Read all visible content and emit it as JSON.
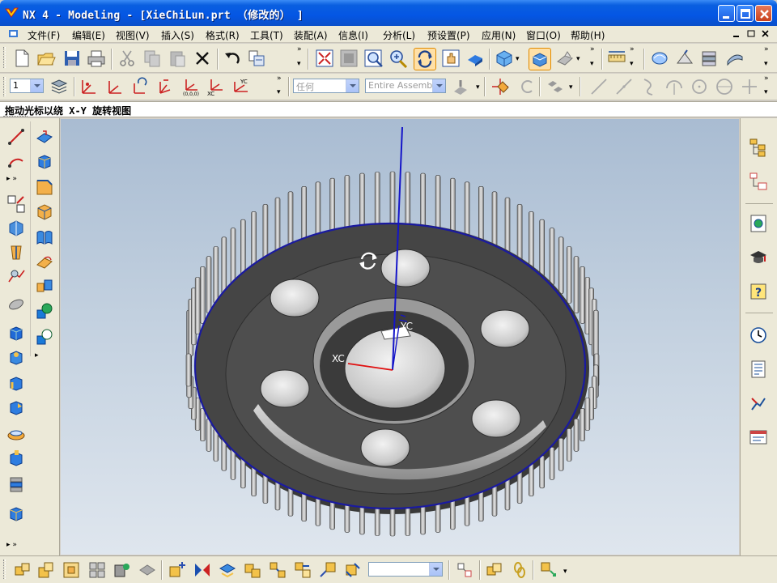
{
  "window": {
    "title": "NX 4 - Modeling - [XieChiLun.prt （修改的） ]"
  },
  "menu": {
    "items": [
      "文件(F)",
      "编辑(E)",
      "视图(V)",
      "插入(S)",
      "格式(R)",
      "工具(T)",
      "装配(A)",
      "信息(I)",
      "分析(L)",
      "预设置(P)",
      "应用(N)",
      "窗口(O)",
      "帮助(H)"
    ]
  },
  "toolbar2": {
    "layer_value": "1",
    "filter_value": "任何",
    "assembly_value": "Entire Assemb"
  },
  "cue_line": "拖动光标以绕 X-Y 旋转视图",
  "viewport": {
    "wcs_labels": {
      "x": "XC",
      "y": "YC"
    }
  },
  "colors": {
    "title_blue": "#0456e4",
    "menu_bg": "#ece9d8",
    "gear_dark": "#454545",
    "edge_blue": "#1a1aa0"
  },
  "icons": {
    "app": "nx-logo-icon",
    "rotate": "rotate-cursor-icon"
  }
}
